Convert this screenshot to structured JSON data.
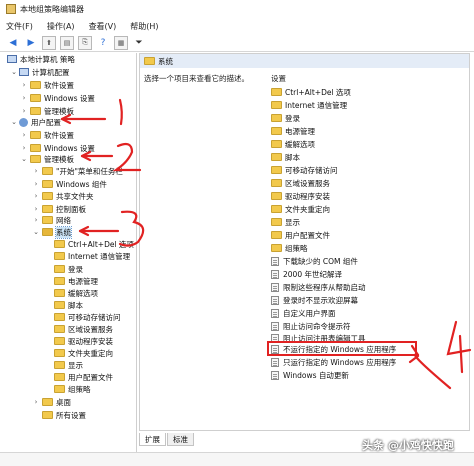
{
  "window": {
    "title": "本地组策略编辑器"
  },
  "menu": [
    "文件(F)",
    "操作(A)",
    "查看(V)",
    "帮助(H)"
  ],
  "tree": {
    "root": "本地计算机 策略",
    "computer_config": "计算机配置",
    "cc_software": "软件设置",
    "cc_windows": "Windows 设置",
    "cc_admin": "管理模板",
    "user_config": "用户配置",
    "uc_software": "软件设置",
    "uc_windows": "Windows 设置",
    "uc_admin": "管理模板",
    "start_menu": "\"开始\"菜单和任务栏",
    "windows_components": "Windows 组件",
    "shared_folders": "共享文件夹",
    "control_panel": "控制面板",
    "network": "网络",
    "system": "系统",
    "sys_children": [
      "Ctrl+Alt+Del 选项",
      "Internet 通信管理",
      "登录",
      "电源管理",
      "缓解选项",
      "脚本",
      "可移动存储访问",
      "区域设置服务",
      "驱动程序安装",
      "文件夹重定向",
      "显示",
      "用户配置文件",
      "组策略"
    ],
    "desktop": "桌面",
    "all_settings": "所有设置"
  },
  "right": {
    "header": "系统",
    "description": "选择一个项目来查看它的描述。",
    "column": "设置",
    "folders": [
      "Ctrl+Alt+Del 选项",
      "Internet 通信管理",
      "登录",
      "电源管理",
      "缓解选项",
      "脚本",
      "可移动存储访问",
      "区域设置服务",
      "驱动程序安装",
      "文件夹重定向",
      "显示",
      "用户配置文件",
      "组策略"
    ],
    "policies": [
      "下载缺少的 COM 组件",
      "2000 年世纪解译",
      "限制这些程序从帮助启动",
      "登录时不显示欢迎屏幕",
      "自定义用户界面",
      "阻止访问命令提示符",
      "阻止访问注册表编辑工具",
      "不运行指定的 Windows 应用程序",
      "只运行指定的 Windows 应用程序",
      "Windows 自动更新"
    ]
  },
  "tabs": {
    "extended": "扩展",
    "standard": "标准"
  },
  "annotations": {
    "n1": "1",
    "n2": "2",
    "n3": "3",
    "n4": "4",
    "color": "#e12222"
  },
  "watermark": "头条 @小鸡快快跑"
}
